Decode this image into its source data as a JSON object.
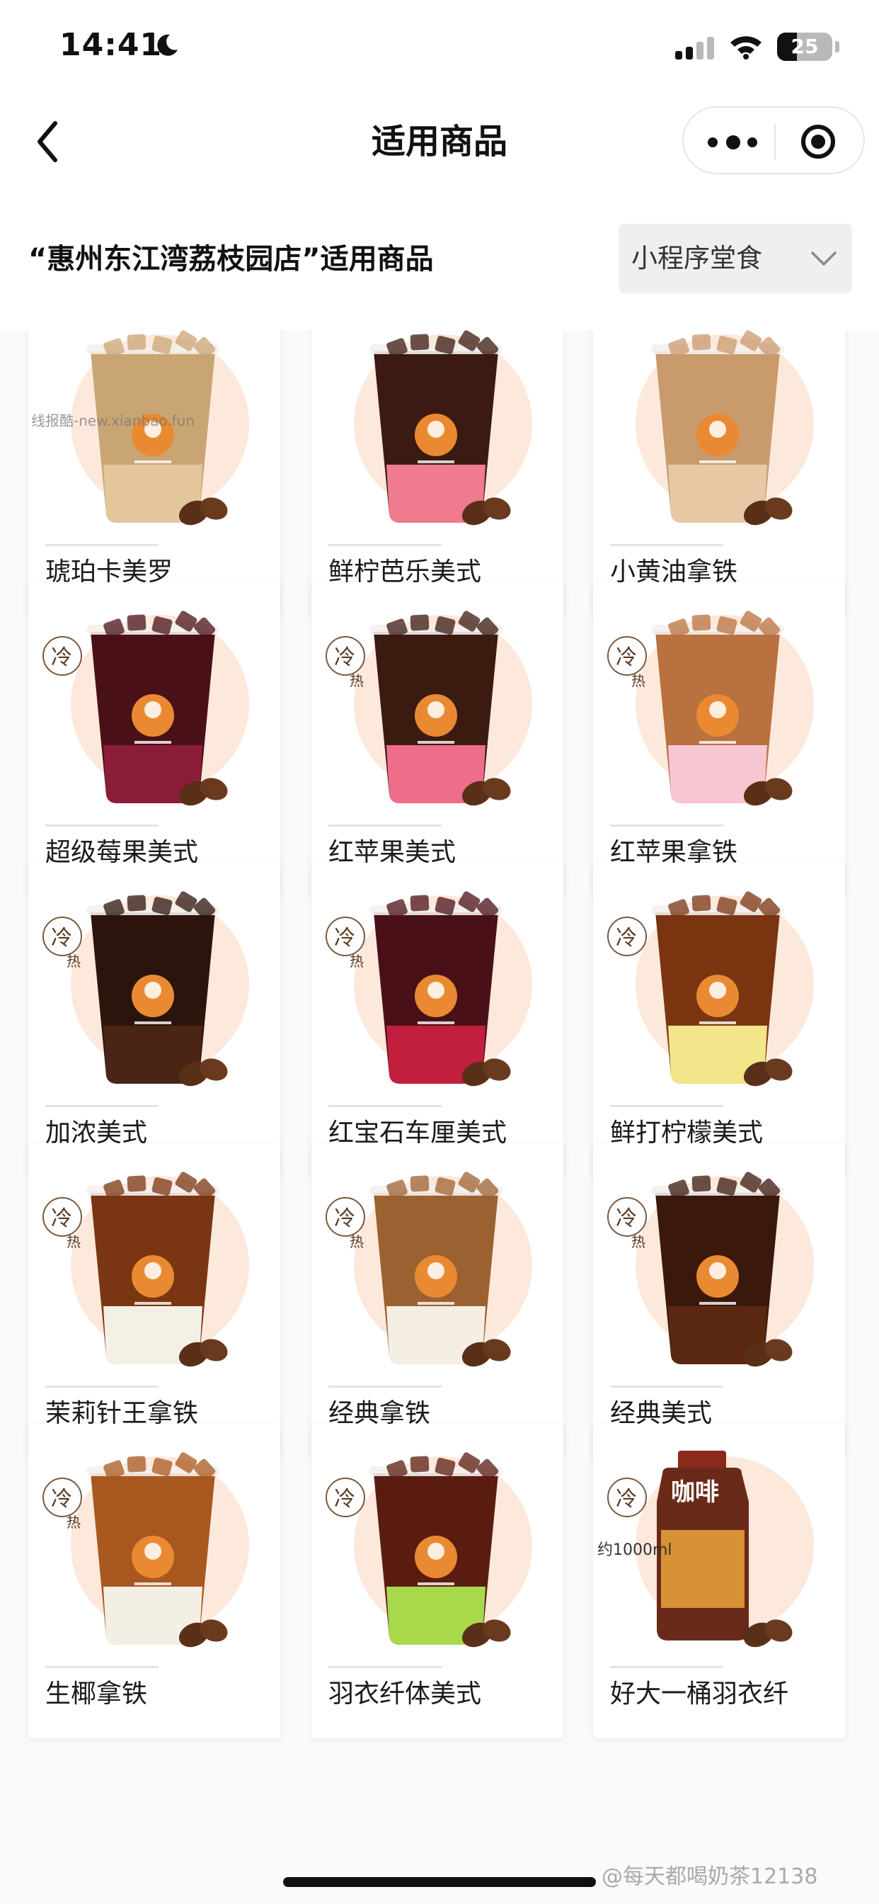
{
  "status_bar": {
    "time": "14:41",
    "battery": "25"
  },
  "nav": {
    "title": "适用商品",
    "back_icon": "chevron-left-icon",
    "more_icon": "more-dots-icon",
    "close_icon": "target-close-icon"
  },
  "header": {
    "store_heading": "“惠州东江湾荔枝园店”适用商品",
    "mode_selected": "小程序堂食"
  },
  "watermark": "线报酷-new.xianbao.fun",
  "footer_watermark": "@每天都喝奶茶12138",
  "products": [
    {
      "name": "琥珀卡美罗",
      "drink": "#caa574",
      "layer": "#e3c69b",
      "badge": ""
    },
    {
      "name": "鲜柠芭乐美式",
      "drink": "#3a1a12",
      "layer": "#f07a8e",
      "badge": ""
    },
    {
      "name": "小黄油拿铁",
      "drink": "#c99a6c",
      "layer": "#e6c8a5",
      "badge": ""
    },
    {
      "name": "超级莓果美式",
      "drink": "#4a1018",
      "layer": "#8b1c3a",
      "badge": "冷"
    },
    {
      "name": "红苹果美式",
      "drink": "#3b1a10",
      "layer": "#ee6d8a",
      "badge": "冷热"
    },
    {
      "name": "红苹果拿铁",
      "drink": "#b8713f",
      "layer": "#f6c6d3",
      "badge": "冷热"
    },
    {
      "name": "加浓美式",
      "drink": "#2c140c",
      "layer": "#4a2414",
      "badge": "冷热"
    },
    {
      "name": "红宝石车厘美式",
      "drink": "#4a1018",
      "layer": "#c21e3e",
      "badge": "冷热"
    },
    {
      "name": "鲜打柠檬美式",
      "drink": "#7a3410",
      "layer": "#f2e58a",
      "badge": "冷"
    },
    {
      "name": "茉莉针王拿铁",
      "drink": "#7a3512",
      "layer": "#f4f0e6",
      "badge": "冷热"
    },
    {
      "name": "经典拿铁",
      "drink": "#9c6131",
      "layer": "#f4eee3",
      "badge": "冷热"
    },
    {
      "name": "经典美式",
      "drink": "#3a180c",
      "layer": "#5a2810",
      "badge": "冷热"
    },
    {
      "name": "生椰拿铁",
      "drink": "#a8581f",
      "layer": "#f4efe4",
      "badge": "冷热"
    },
    {
      "name": "羽衣纤体美式",
      "drink": "#5a1c10",
      "layer": "#a8d94a",
      "badge": "冷"
    },
    {
      "name": "好大一桶羽衣纤",
      "drink": "#6a2a1a",
      "layer": "#e9a43a",
      "badge": "冷",
      "capacity": "约1000ml",
      "bottle_label": "咖啡"
    }
  ]
}
